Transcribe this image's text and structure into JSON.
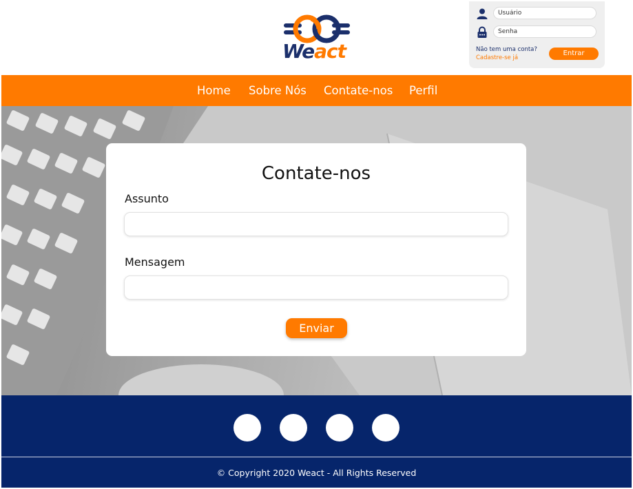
{
  "brand": {
    "name_we": "We",
    "name_act": "act",
    "orange": "#ff7a00",
    "navy": "#06256b"
  },
  "login": {
    "user_icon": "user-icon",
    "user_placeholder": "Usuário",
    "lock_icon": "lock-icon",
    "password_placeholder": "Senha",
    "question": "Não tem uma conta?",
    "signup": "Cadastre-se já",
    "button": "Entrar"
  },
  "nav": {
    "items": [
      "Home",
      "Sobre Nós",
      "Contate-nos",
      "Perfil"
    ]
  },
  "contact": {
    "title": "Contate-nos",
    "subject_label": "Assunto",
    "subject_value": "",
    "message_label": "Mensagem",
    "message_value": "",
    "submit": "Enviar"
  },
  "footer": {
    "social_icons": [
      "social-icon",
      "social-icon",
      "social-icon",
      "social-icon"
    ],
    "copyright": "© Copyright 2020 Weact - All Rights Reserved"
  }
}
